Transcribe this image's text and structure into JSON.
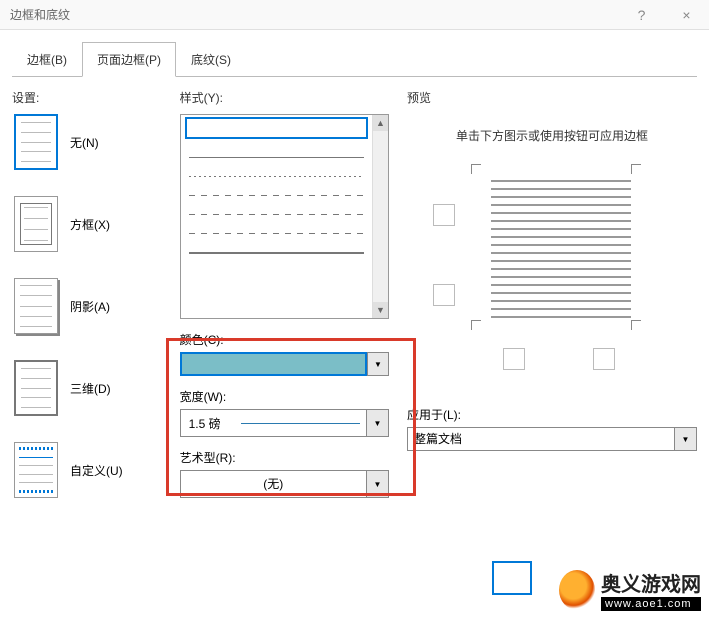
{
  "window": {
    "title": "边框和底纹",
    "help": "?",
    "close": "×"
  },
  "tabs": {
    "borders": "边框(B)",
    "page_borders": "页面边框(P)",
    "shading": "底纹(S)"
  },
  "settings": {
    "label": "设置:",
    "items": [
      {
        "label": "无(N)"
      },
      {
        "label": "方框(X)"
      },
      {
        "label": "阴影(A)"
      },
      {
        "label": "三维(D)"
      },
      {
        "label": "自定义(U)"
      }
    ]
  },
  "style": {
    "label": "样式(Y):",
    "color_label": "颜色(C):",
    "color_value": "#7bbec7",
    "width_label": "宽度(W):",
    "width_value": "1.5 磅",
    "art_label": "艺术型(R):",
    "art_value": "(无)"
  },
  "preview": {
    "label": "预览",
    "hint": "单击下方图示或使用按钮可应用边框",
    "apply_label": "应用于(L):",
    "apply_value": "整篇文档"
  },
  "watermark": {
    "name": "奥义游戏网",
    "url": "www.aoe1.com"
  }
}
